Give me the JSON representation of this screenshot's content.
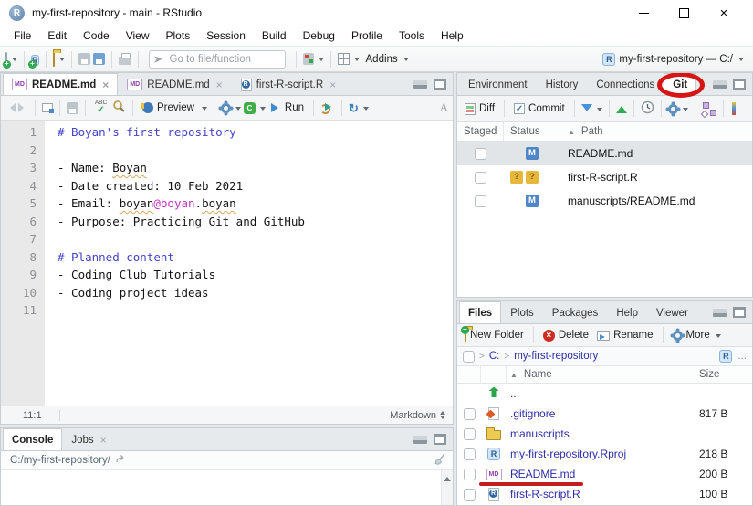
{
  "window": {
    "title": "my-first-repository - main - RStudio"
  },
  "menu": {
    "items": [
      "File",
      "Edit",
      "Code",
      "View",
      "Plots",
      "Session",
      "Build",
      "Debug",
      "Profile",
      "Tools",
      "Help"
    ]
  },
  "toolbar": {
    "goto_placeholder": "Go to file/function",
    "addins_label": "Addins",
    "project_label": "my-first-repository — C:/"
  },
  "editor": {
    "tabs": [
      {
        "label": "README.md",
        "icon": "md-file",
        "active": true
      },
      {
        "label": "README.md",
        "icon": "md-file",
        "active": false
      },
      {
        "label": "first-R-script.R",
        "icon": "r-script",
        "active": false
      }
    ],
    "toolbar": {
      "preview_label": "Preview",
      "run_label": "Run"
    },
    "lines": [
      {
        "num": "1",
        "parts": [
          {
            "t": "# Boyan's first repository",
            "c": "head"
          }
        ]
      },
      {
        "num": "2",
        "parts": []
      },
      {
        "num": "3",
        "parts": [
          {
            "t": "- Name: ",
            "c": "plain"
          },
          {
            "t": "Boyan",
            "c": "sp"
          }
        ]
      },
      {
        "num": "4",
        "parts": [
          {
            "t": "- Date created: 10 Feb 2021",
            "c": "plain"
          }
        ]
      },
      {
        "num": "5",
        "parts": [
          {
            "t": "- Email: ",
            "c": "plain"
          },
          {
            "t": "boyan",
            "c": "sp"
          },
          {
            "t": "@boyan",
            "c": "at"
          },
          {
            "t": ".",
            "c": "plain"
          },
          {
            "t": "boyan",
            "c": "sp"
          }
        ]
      },
      {
        "num": "6",
        "parts": [
          {
            "t": "- Purpose: Practicing Git and GitHub",
            "c": "plain"
          }
        ]
      },
      {
        "num": "7",
        "parts": []
      },
      {
        "num": "8",
        "parts": [
          {
            "t": "# Planned content",
            "c": "head"
          }
        ]
      },
      {
        "num": "9",
        "parts": [
          {
            "t": "- Coding Club Tutorials",
            "c": "plain"
          }
        ]
      },
      {
        "num": "10",
        "parts": [
          {
            "t": "- Coding project ideas",
            "c": "plain"
          }
        ]
      },
      {
        "num": "11",
        "parts": []
      }
    ],
    "status": {
      "cursor": "11:1",
      "mode": "Markdown"
    }
  },
  "console": {
    "tabs": [
      {
        "label": "Console",
        "active": true,
        "closable": false
      },
      {
        "label": "Jobs",
        "active": false,
        "closable": true
      }
    ],
    "working_dir": "C:/my-first-repository/"
  },
  "git": {
    "tabs": [
      {
        "label": "Environment",
        "active": false,
        "circled": false
      },
      {
        "label": "History",
        "active": false,
        "circled": false
      },
      {
        "label": "Connections",
        "active": false,
        "circled": false
      },
      {
        "label": "Git",
        "active": true,
        "circled": true
      }
    ],
    "toolbar": {
      "diff_label": "Diff",
      "commit_label": "Commit"
    },
    "columns": [
      "Staged",
      "Status",
      "Path"
    ],
    "sorted_column": "Path",
    "rows": [
      {
        "staged": false,
        "status": "M",
        "path": "README.md",
        "selected": true
      },
      {
        "staged": false,
        "status": "??",
        "path": "first-R-script.R",
        "selected": false
      },
      {
        "staged": false,
        "status": "M",
        "path": "manuscripts/README.md",
        "selected": false
      }
    ]
  },
  "files": {
    "tabs": [
      {
        "label": "Files",
        "active": true
      },
      {
        "label": "Plots",
        "active": false
      },
      {
        "label": "Packages",
        "active": false
      },
      {
        "label": "Help",
        "active": false
      },
      {
        "label": "Viewer",
        "active": false
      }
    ],
    "toolbar": {
      "new_folder_label": "New Folder",
      "delete_label": "Delete",
      "rename_label": "Rename",
      "more_label": "More",
      "ellipsis_label": "..."
    },
    "breadcrumb": [
      "C:",
      "my-first-repository"
    ],
    "columns": [
      "Name",
      "Size"
    ],
    "sorted_column": "Name",
    "rows": [
      {
        "icon": "up-dir",
        "name": "..",
        "size": "",
        "checkbox": false,
        "red_underline": false
      },
      {
        "icon": "gitignore-file",
        "name": ".gitignore",
        "size": "817 B",
        "checkbox": true,
        "red_underline": false
      },
      {
        "icon": "folder",
        "name": "manuscripts",
        "size": "",
        "checkbox": true,
        "red_underline": false
      },
      {
        "icon": "r-project",
        "name": "my-first-repository.Rproj",
        "size": "218 B",
        "checkbox": true,
        "red_underline": false
      },
      {
        "icon": "md-file",
        "name": "README.md",
        "size": "200 B",
        "checkbox": true,
        "red_underline": true
      },
      {
        "icon": "r-script",
        "name": "first-R-script.R",
        "size": "100 B",
        "checkbox": true,
        "red_underline": false
      }
    ]
  },
  "colors": {
    "annotation_red": "#d61515",
    "md_heading": "#4444cb",
    "email_highlight": "#c32fc3",
    "file_link": "#2d2da8",
    "modified_badge": "#4d87c7",
    "untracked_badge": "#e7b73a"
  }
}
